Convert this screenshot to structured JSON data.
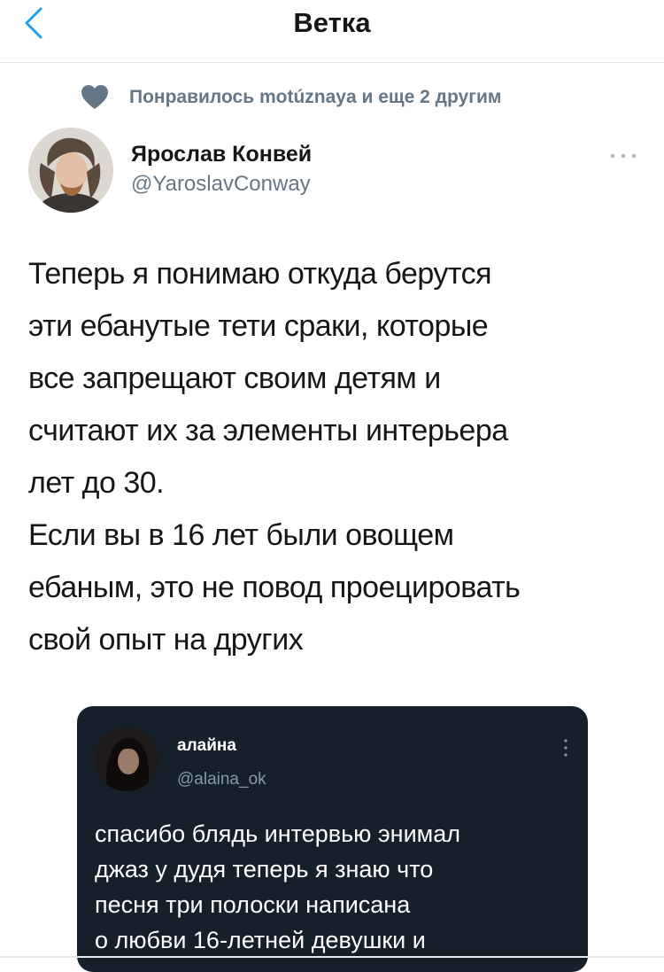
{
  "header": {
    "title": "Ветка"
  },
  "social_context": {
    "text": "Понравилось motúznaya и еще 2 другим"
  },
  "tweet": {
    "author_name": "Ярослав Конвей",
    "author_handle": "@YaroslavConway",
    "text_lines": [
      "Теперь я понимаю откуда берутся",
      "эти ебанутые тети сраки, которые",
      "все запрещают своим детям и",
      "считают их за элементы интерьера",
      "лет до 30.",
      "Если вы в 16 лет были овощем",
      "ебаным, это не повод проецировать",
      "свой опыт на других"
    ]
  },
  "embedded_tweet": {
    "author_name": "алайна",
    "author_handle": "@alaina_ok",
    "text_lines": [
      "спасибо блядь интервью энимал",
      "джаз у дудя теперь я знаю что",
      "песня три полоски написана",
      "о любви 16-летней девушки и"
    ]
  },
  "colors": {
    "accent": "#1da1f2",
    "secondary_text": "#657786",
    "embed_background": "#15202b"
  },
  "icons": {
    "back": "chevron-left-icon",
    "like": "heart-icon",
    "more": "more-horizontal-icon",
    "embed_more": "more-vertical-icon"
  }
}
